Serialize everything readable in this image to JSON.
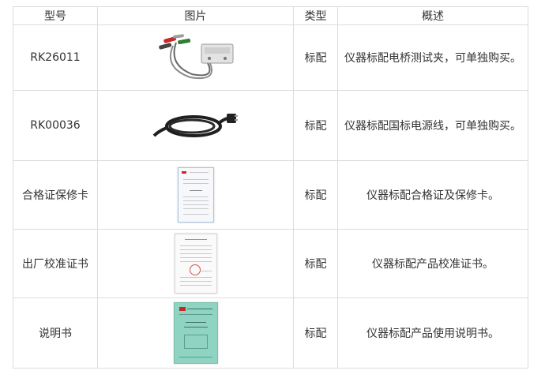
{
  "headers": [
    "型号",
    "图片",
    "类型",
    "概述"
  ],
  "rows": [
    {
      "model": "RK26011",
      "image_icon": "clip-test-lead-icon",
      "type": "标配",
      "desc": "仪器标配电桥测试夹，可单独购买。"
    },
    {
      "model": "RK00036",
      "image_icon": "power-cord-icon",
      "type": "标配",
      "desc": "仪器标配国标电源线，可单独购买。"
    },
    {
      "model": "合格证保修卡",
      "image_icon": "warranty-card-icon",
      "type": "标配",
      "desc": "仪器标配合格证及保修卡。"
    },
    {
      "model": "出厂校准证书",
      "image_icon": "calibration-certificate-icon",
      "type": "标配",
      "desc": "仪器标配产品校准证书。"
    },
    {
      "model": "说明书",
      "image_icon": "manual-booklet-icon",
      "type": "标配",
      "desc": "仪器标配产品使用说明书。"
    }
  ],
  "colors": {
    "border": "#dcdcdc",
    "text": "#333333",
    "manual_cover": "#8fd4c2"
  }
}
